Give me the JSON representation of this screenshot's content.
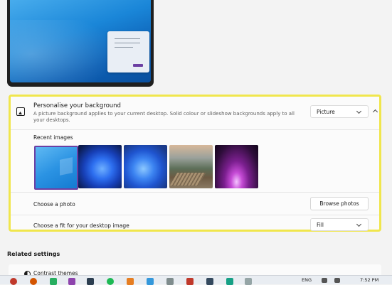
{
  "background_section": {
    "title": "Personalise your background",
    "description": "A picture background applies to your current desktop. Solid colour or slideshow backgrounds apply to all your desktops.",
    "type_dropdown": {
      "selected": "Picture"
    },
    "recent_images_label": "Recent images",
    "recent_images": [
      {
        "name": "Windows blue default",
        "selected": true
      },
      {
        "name": "Blue bloom dark"
      },
      {
        "name": "Blue bloom light"
      },
      {
        "name": "Landscape boardwalk"
      },
      {
        "name": "Purple glow"
      }
    ],
    "choose_photo_label": "Choose a photo",
    "browse_button": "Browse photos",
    "fit_label": "Choose a fit for your desktop image",
    "fit_dropdown": {
      "selected": "Fill"
    }
  },
  "related_settings": {
    "heading": "Related settings",
    "contrast_themes": "Contrast themes"
  },
  "taskbar": {
    "language": "ENG",
    "clock": "7:52 PM"
  },
  "colors": {
    "highlight_border": "#f0e64c",
    "selection_accent": "#6c3fa3"
  }
}
